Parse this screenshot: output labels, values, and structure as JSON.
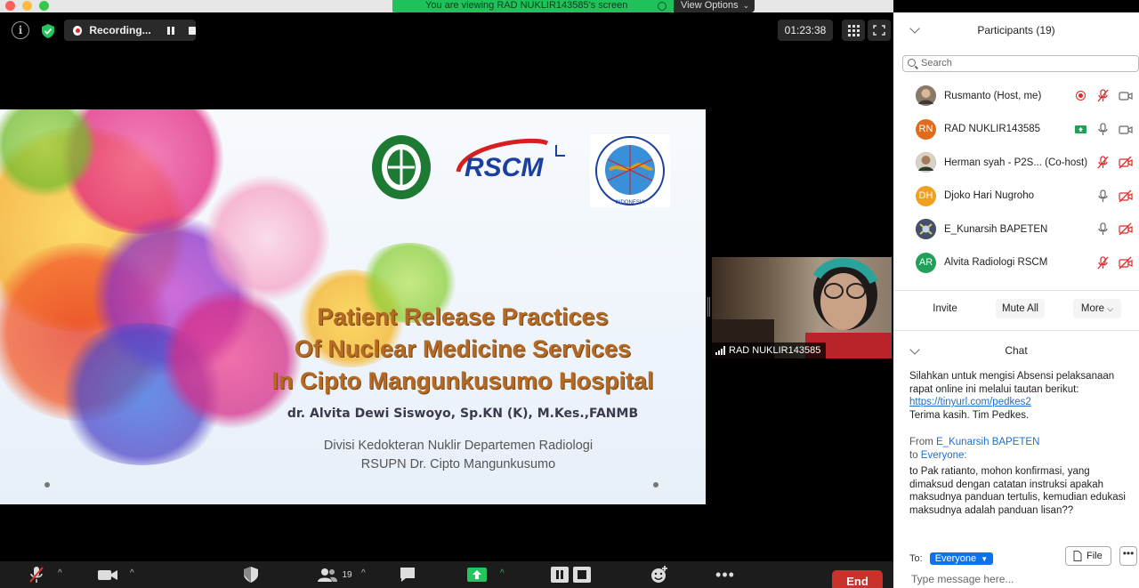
{
  "banner": {
    "viewing": "You are viewing RAD NUKLIR143585's screen",
    "view_options": "View Options"
  },
  "recording": {
    "label": "Recording..."
  },
  "timer": "01:23:38",
  "slide": {
    "title_lines": [
      "Patient Release Practices",
      "Of Nuclear Medicine Services",
      "In Cipto Mangunkusumo Hospital"
    ],
    "author": "dr. Alvita Dewi Siswoyo, Sp.KN (K), M.Kes.,FANMB",
    "division_lines": [
      "Divisi Kedokteran Nuklir Departemen Radiologi",
      "RSUPN Dr. Cipto Mangunkusumo"
    ],
    "logo_rscm": "RSCM",
    "logo_pkni_bottom": "INDONESIA"
  },
  "speaker": {
    "name": "RAD NUKLIR143585"
  },
  "toolbar": {
    "participants_count": "19",
    "end_label": "End"
  },
  "participants": {
    "title": "Participants (19)",
    "search_placeholder": "Search",
    "list": [
      {
        "name": "Rusmanto (Host, me)",
        "initials": "",
        "color": "#8a7a6a"
      },
      {
        "name": "RAD NUKLIR143585",
        "initials": "RN",
        "color": "#e16b1a"
      },
      {
        "name": "Herman syah - P2S... (Co-host)",
        "initials": "",
        "color": "#5a5040"
      },
      {
        "name": "Djoko Hari Nugroho",
        "initials": "DH",
        "color": "#f0a020"
      },
      {
        "name": "E_Kunarsih BAPETEN",
        "initials": "",
        "color": "#44506a"
      },
      {
        "name": "Alvita Radiologi RSCM",
        "initials": "AR",
        "color": "#22a05a"
      }
    ],
    "invite": "Invite",
    "mute_all": "Mute All",
    "more": "More"
  },
  "chat": {
    "title": "Chat",
    "msg1_text": "Silahkan untuk mengisi Absensi pelaksanaan rapat online ini melalui tautan berikut: ",
    "msg1_link": "https://tinyurl.com/pedkes2",
    "msg1_thanks": "Terima kasih. Tim Pedkes.",
    "from_label": "From",
    "from_name": "E_Kunarsih BAPETEN",
    "to_label": "to",
    "to_name": "Everyone:",
    "msg2": "to Pak ratianto, mohon konfirmasi, yang dimaksud dengan catatan instruksi apakah maksudnya panduan tertulis, kemudian edukasi maksudnya adalah panduan lisan??",
    "to_prefix": "To:",
    "recipient": "Everyone",
    "file_label": "File",
    "input_placeholder": "Type message here..."
  },
  "colors": {
    "green_banner": "#1fc25a",
    "end_red": "#c8322b",
    "accent_blue": "#0e72ed",
    "slide_title": "#b36a24"
  }
}
